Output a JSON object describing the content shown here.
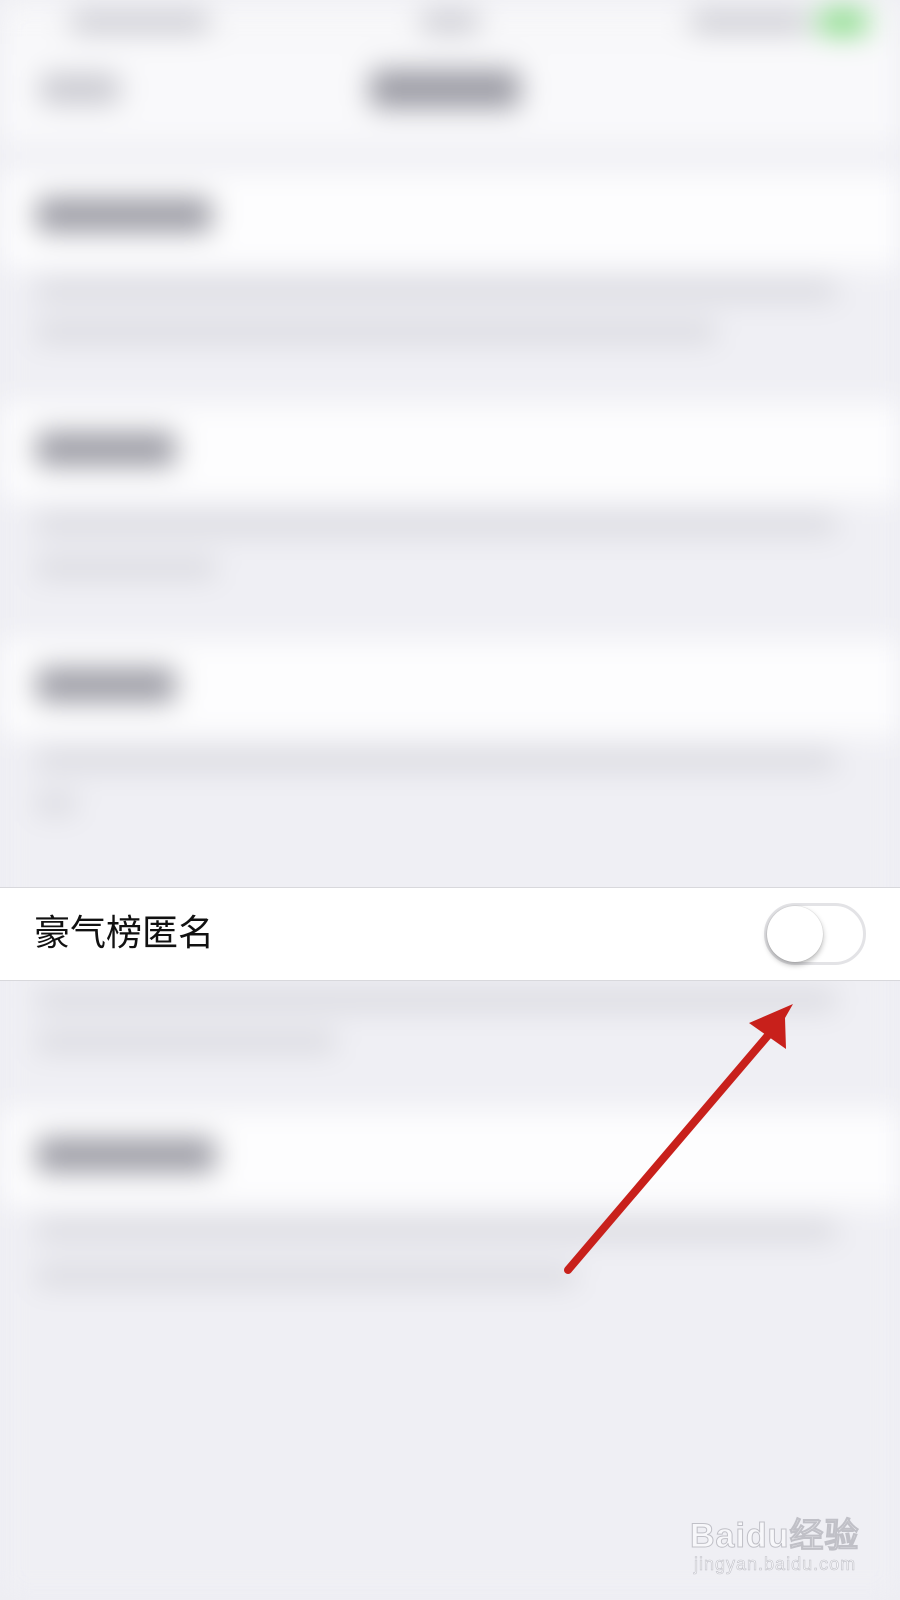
{
  "setting": {
    "label": "豪气榜匿名",
    "toggle_on": false
  },
  "watermark": {
    "logo_text": "Baidu",
    "logo_suffix": "经验",
    "url": "jingyan.baidu.com"
  },
  "colors": {
    "background": "#efeff4",
    "row_background": "#ffffff",
    "toggle_off_border": "#e3e3e6",
    "arrow": "#c8201b"
  },
  "icons": {
    "annotation": "red-arrow-icon",
    "watermark": "baidu-paw-icon"
  }
}
